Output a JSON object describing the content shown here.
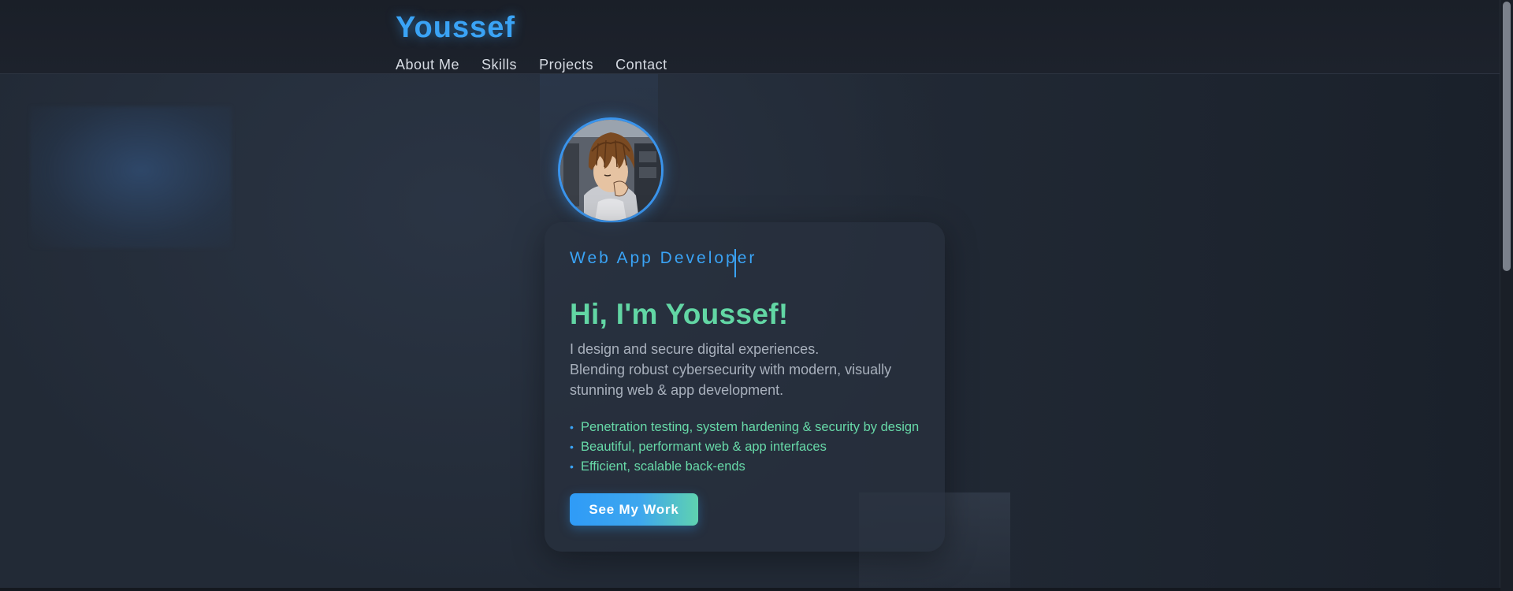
{
  "brand": {
    "name": "Youssef"
  },
  "nav": {
    "links": [
      {
        "label": "About Me"
      },
      {
        "label": "Skills"
      },
      {
        "label": "Projects"
      },
      {
        "label": "Contact"
      }
    ]
  },
  "hero": {
    "role": "Web App Developer",
    "headline": "Hi, I'm Youssef!",
    "intro": [
      "I design and secure digital experiences.",
      "Blending robust cybersecurity with modern, visually",
      "stunning web & app development."
    ],
    "features": [
      "Penetration testing, system hardening & security by design",
      "Beautiful, performant web & app interfaces",
      "Efficient, scalable back-ends"
    ],
    "cta_label": "See My Work",
    "avatar_icon": "anime-character-avatar"
  },
  "colors": {
    "accent_blue": "#3aa3f5",
    "accent_green": "#62d6a4",
    "background": "#222a36"
  }
}
